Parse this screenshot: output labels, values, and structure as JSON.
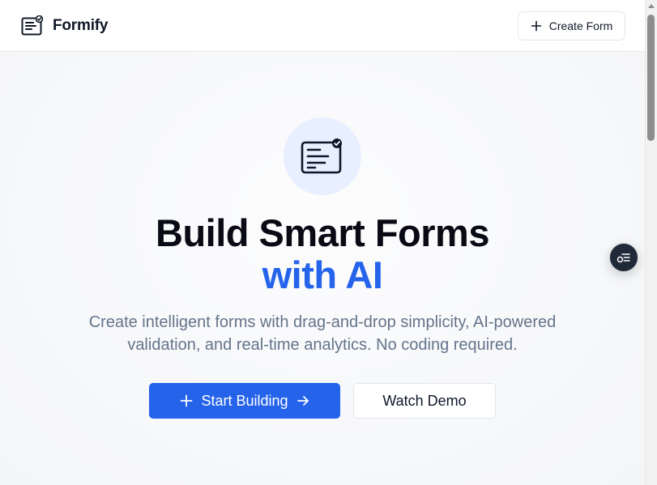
{
  "header": {
    "brand_name": "Formify",
    "brand_icon": "form-check-icon",
    "create_button": {
      "label": "Create Form",
      "icon": "plus-icon"
    }
  },
  "hero": {
    "icon": "form-check-icon",
    "headline_line1": "Build Smart Forms",
    "headline_line2": "with AI",
    "subtitle": "Create intelligent forms with drag-and-drop simplicity, AI-powered validation, and real-time analytics. No coding required.",
    "primary_button": {
      "label": "Start Building",
      "leading_icon": "plus-icon",
      "trailing_icon": "arrow-right-icon"
    },
    "secondary_button": {
      "label": "Watch Demo"
    }
  },
  "floating_action": {
    "icon": "settings-list-icon"
  },
  "colors": {
    "accent": "#2563eb",
    "headline": "#0a0a14",
    "subtitle": "#64748b",
    "icon_circle": "#e8efff",
    "fab_bg": "#1f2937"
  }
}
